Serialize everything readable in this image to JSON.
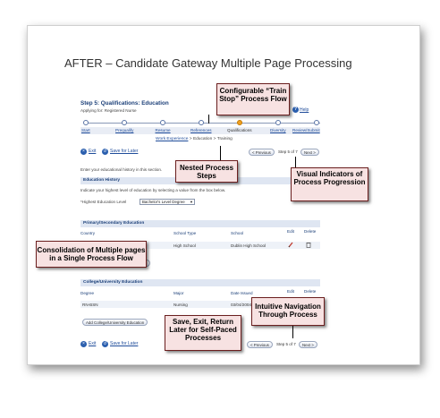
{
  "slide": {
    "title": "AFTER – Candidate Gateway Multiple Page Processing"
  },
  "app": {
    "step_title": "Step 5: Qualifications: Education",
    "applying_for": "Applying for: Registered Nurse",
    "help": "Help",
    "help_icon": "?",
    "train_stops": [
      {
        "label": "Start",
        "current": false
      },
      {
        "label": "Prequalify",
        "current": false
      },
      {
        "label": "Resume",
        "current": false
      },
      {
        "label": "References",
        "current": false
      },
      {
        "label": "Qualifications",
        "current": true
      },
      {
        "label": "Diversity",
        "current": false
      },
      {
        "label": "Review/Submit",
        "current": false
      }
    ],
    "substeps": {
      "work_experience": "Work Experience",
      "sep1": ">",
      "education": "Education",
      "sep2": ">",
      "training": "Training"
    },
    "nav_top": {
      "exit": "Exit",
      "save_for_later": "Save for Later",
      "previous": "< Previous",
      "step_of": "Step 5 of 7",
      "next": "Next >"
    },
    "intro_text": "Enter your educational history in this section.",
    "education_history": {
      "header": "Education History",
      "instruction": "Indicate your highest level of education by selecting a value from the box below.",
      "field_label": "*Highest Education Level",
      "field_value": "Bachelor's Level Degree"
    },
    "primary_secondary": {
      "header": "Primary/Secondary Education",
      "columns": [
        "Country",
        "School Type",
        "School",
        "Edit",
        "Delete"
      ],
      "rows": [
        {
          "country": "",
          "school_type": "High School",
          "school": "Dublin High School"
        }
      ],
      "add_button": "...ion"
    },
    "college": {
      "header": "College/University Education",
      "columns": [
        "Degree",
        "Major",
        "Date Issued",
        "Edit",
        "Delete"
      ],
      "rows": [
        {
          "degree": "RN-BSN",
          "major": "Nursing",
          "date": "03/04/2004"
        }
      ],
      "add_button": "Add College/University Education"
    },
    "nav_bottom": {
      "exit": "Exit",
      "save_for_later": "Save for Later",
      "previous": "< Previous",
      "step_of": "Step 5 of 7",
      "next": "Next >"
    }
  },
  "callouts": {
    "train_stop": "Configurable “Train Stop” Process Flow",
    "nested": "Nested Process Steps",
    "visual": "Visual Indicators of Process Progression",
    "consolidation": "Consolidation of Multiple pages in a Single Process Flow",
    "intuitive": "Intuitive Navigation Through Process",
    "save_exit": "Save, Exit, Return Later for Self-Paced Processes"
  }
}
